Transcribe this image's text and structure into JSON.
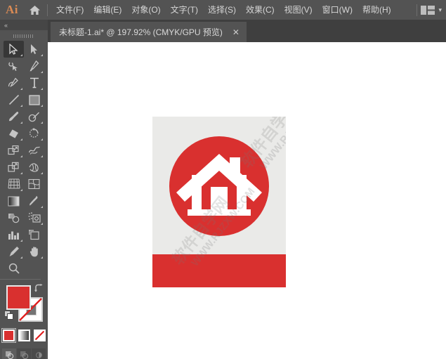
{
  "app": {
    "logo_text": "Ai",
    "home_icon": "home-icon",
    "workspace_icon": "workspace-layout-icon",
    "workspace_chevron": "▾"
  },
  "menubar": {
    "items": [
      {
        "label": "文件(F)",
        "name": "menu-file"
      },
      {
        "label": "编辑(E)",
        "name": "menu-edit"
      },
      {
        "label": "对象(O)",
        "name": "menu-object"
      },
      {
        "label": "文字(T)",
        "name": "menu-type"
      },
      {
        "label": "选择(S)",
        "name": "menu-select"
      },
      {
        "label": "效果(C)",
        "name": "menu-effect"
      },
      {
        "label": "视图(V)",
        "name": "menu-view"
      },
      {
        "label": "窗口(W)",
        "name": "menu-window"
      },
      {
        "label": "帮助(H)",
        "name": "menu-help"
      }
    ]
  },
  "tabbar": {
    "document_title": "未标题-1.ai* @ 197.92% (CMYK/GPU 预览)",
    "close_glyph": "✕"
  },
  "toolpanel": {
    "collapse_glyph": "«",
    "tools": [
      {
        "name": "selection-tool",
        "active": true,
        "menu": true
      },
      {
        "name": "direct-selection-tool",
        "active": false,
        "menu": true
      },
      {
        "name": "magic-wand-tool",
        "active": false,
        "menu": false
      },
      {
        "name": "pen-tool",
        "active": false,
        "menu": true
      },
      {
        "name": "curvature-tool",
        "active": false,
        "menu": true
      },
      {
        "name": "type-tool",
        "active": false,
        "menu": true
      },
      {
        "name": "line-segment-tool",
        "active": false,
        "menu": true
      },
      {
        "name": "rectangle-tool",
        "active": false,
        "menu": true
      },
      {
        "name": "paintbrush-tool",
        "active": false,
        "menu": true
      },
      {
        "name": "blob-brush-tool",
        "active": false,
        "menu": true
      },
      {
        "name": "eraser-tool",
        "active": false,
        "menu": true
      },
      {
        "name": "rotate-tool",
        "active": false,
        "menu": true
      },
      {
        "name": "scale-tool",
        "active": false,
        "menu": true
      },
      {
        "name": "width-warp-tool",
        "active": false,
        "menu": true
      },
      {
        "name": "free-transform-tool",
        "active": false,
        "menu": true
      },
      {
        "name": "shape-builder-tool",
        "active": false,
        "menu": true
      },
      {
        "name": "perspective-grid-tool",
        "active": false,
        "menu": true
      },
      {
        "name": "mesh-tool",
        "active": false,
        "menu": false
      },
      {
        "name": "gradient-tool",
        "active": false,
        "menu": false
      },
      {
        "name": "eyedropper-tool",
        "active": false,
        "menu": true
      },
      {
        "name": "blend-tool",
        "active": false,
        "menu": false
      },
      {
        "name": "symbol-sprayer-tool",
        "active": false,
        "menu": true
      },
      {
        "name": "column-graph-tool",
        "active": false,
        "menu": true
      },
      {
        "name": "artboard-tool",
        "active": false,
        "menu": false
      },
      {
        "name": "slice-tool",
        "active": false,
        "menu": true
      },
      {
        "name": "hand-tool",
        "active": false,
        "menu": true
      },
      {
        "name": "zoom-tool",
        "active": false,
        "menu": false
      }
    ],
    "swatches": {
      "fill_color": "#D9302F",
      "stroke_color": "#FFFFFF",
      "stroke_is_none": true,
      "swap_icon": "swap-fill-stroke-icon",
      "default_icon": "default-fill-stroke-icon"
    },
    "fill_modes": [
      {
        "name": "color-mode-button",
        "selected": true
      },
      {
        "name": "gradient-mode-button",
        "selected": false
      },
      {
        "name": "none-mode-button",
        "selected": false
      }
    ],
    "draw_modes": [
      {
        "name": "draw-normal-button",
        "selected": true
      },
      {
        "name": "draw-behind-button",
        "selected": false
      },
      {
        "name": "draw-inside-button",
        "selected": false
      }
    ]
  },
  "artwork": {
    "background_color": "#EAEAE8",
    "circle_color": "#D9302F",
    "house_color": "#FFFFFF",
    "bottom_bar_color": "#D9302F",
    "watermark_latin": "WWW.RJZXW.COM",
    "watermark_cn": "软件自学网"
  }
}
